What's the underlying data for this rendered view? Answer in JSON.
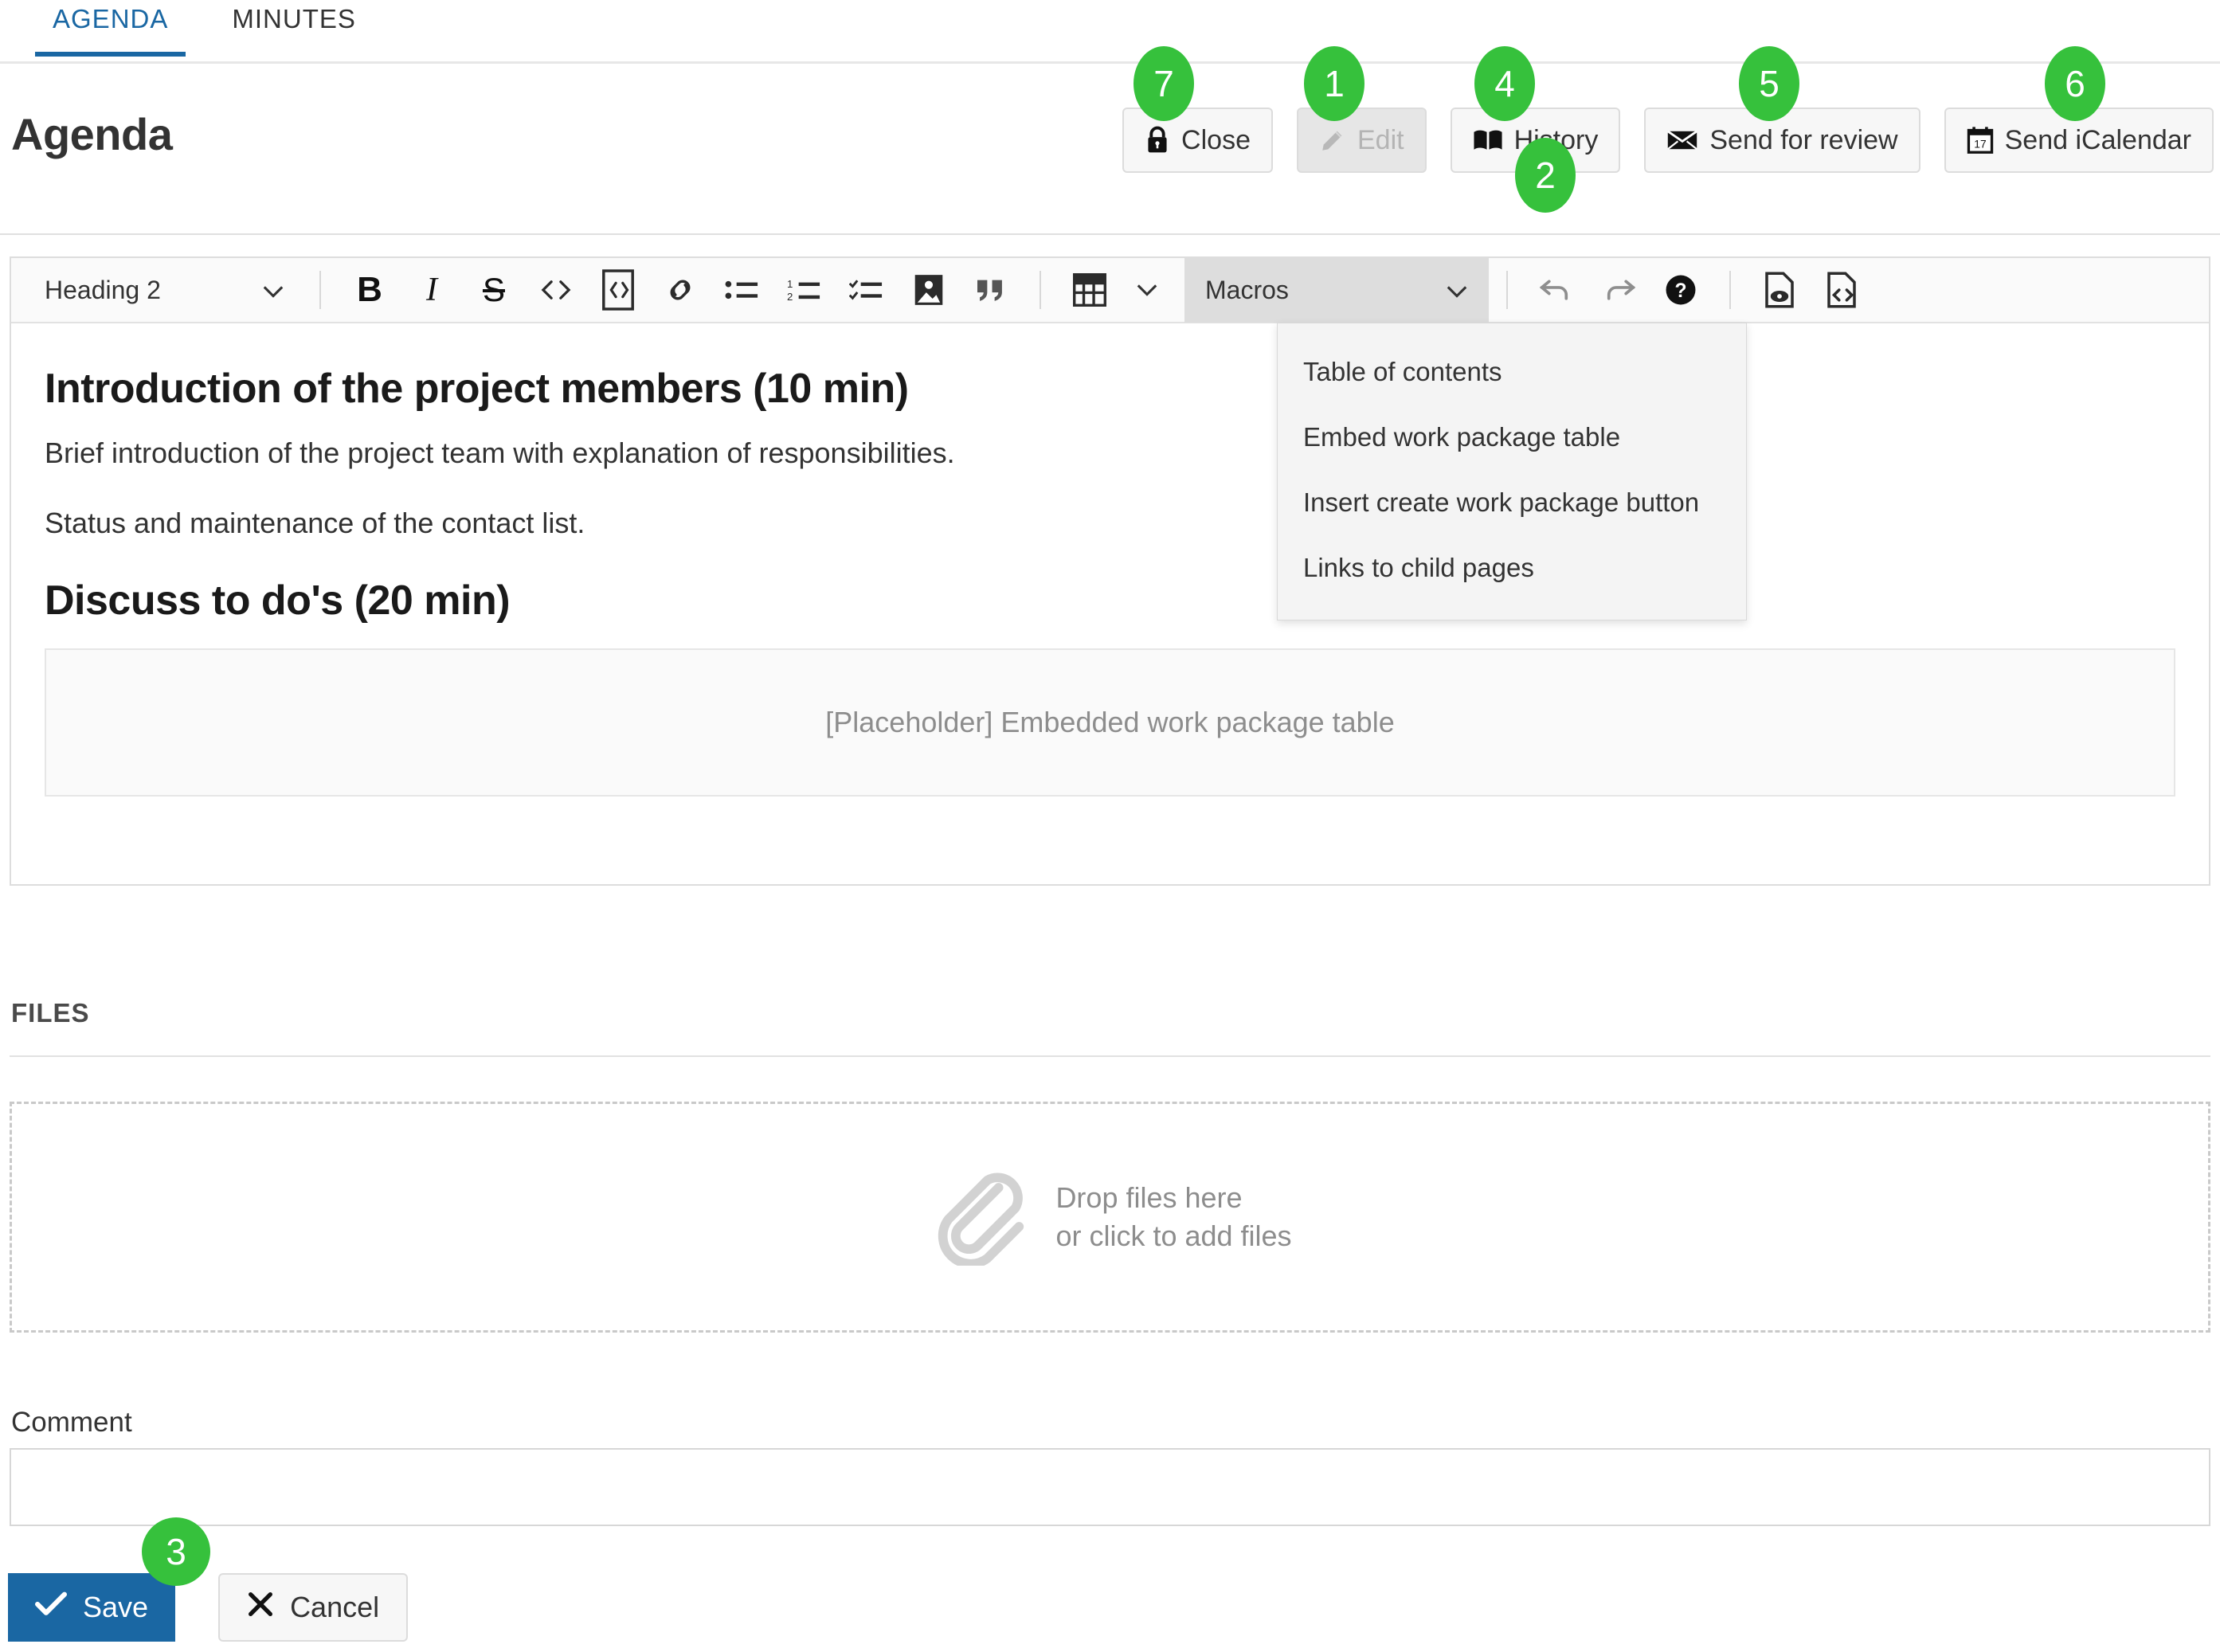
{
  "tabs": [
    {
      "label": "AGENDA",
      "active": true
    },
    {
      "label": "MINUTES",
      "active": false
    }
  ],
  "header": {
    "title": "Agenda",
    "buttons": [
      {
        "label": "Close",
        "icon": "lock-icon",
        "disabled": false,
        "badge": "7"
      },
      {
        "label": "Edit",
        "icon": "pencil-icon",
        "disabled": true,
        "badge": "1"
      },
      {
        "label": "History",
        "icon": "book-icon",
        "disabled": false,
        "badge": "4"
      },
      {
        "label": "Send for review",
        "icon": "envelope-icon",
        "disabled": false,
        "badge": "5"
      },
      {
        "label": "Send iCalendar",
        "icon": "calendar-icon",
        "disabled": false,
        "badge": "6"
      }
    ]
  },
  "editor": {
    "heading_select": {
      "value": "Heading 2"
    },
    "macro_select": {
      "value": "Macros",
      "badge": "2"
    },
    "tools": [
      {
        "name": "bold-icon",
        "label": "B"
      },
      {
        "name": "italic-icon",
        "label": "I"
      },
      {
        "name": "strikethrough-icon",
        "label": "S"
      },
      {
        "name": "inline-code-icon",
        "label": "<>"
      },
      {
        "name": "code-block-icon",
        "label": "<>"
      },
      {
        "name": "link-icon",
        "label": "link"
      },
      {
        "name": "bulleted-list-icon",
        "label": "bullets"
      },
      {
        "name": "numbered-list-icon",
        "label": "numbers"
      },
      {
        "name": "todo-list-icon",
        "label": "todo"
      },
      {
        "name": "image-icon",
        "label": "image"
      },
      {
        "name": "blockquote-icon",
        "label": "quote"
      },
      {
        "name": "table-icon",
        "label": "table"
      },
      {
        "name": "undo-icon",
        "label": "undo"
      },
      {
        "name": "redo-icon",
        "label": "redo"
      },
      {
        "name": "help-icon",
        "label": "help"
      },
      {
        "name": "preview-icon",
        "label": "preview"
      },
      {
        "name": "source-code-icon",
        "label": "source"
      }
    ],
    "macro_menu": [
      "Table of contents",
      "Embed work package table",
      "Insert create work package button",
      "Links to child pages"
    ],
    "content": {
      "heading_1": "Introduction of the project members (10 min)",
      "paragraph_1": "Brief introduction of the project team with explanation of responsibilities.",
      "paragraph_2": "Status and maintenance of the contact list.",
      "heading_2": "Discuss to do's (20 min)",
      "embedded_placeholder": "[Placeholder] Embedded work package table"
    }
  },
  "files": {
    "section_label": "FILES",
    "dropzone_line_1": "Drop files here",
    "dropzone_line_2": "or click to add files",
    "dropzone_icon": "paperclip-icon"
  },
  "comment": {
    "label": "Comment",
    "value": "",
    "placeholder": ""
  },
  "actions": {
    "save_label": "Save",
    "save_badge": "3",
    "cancel_label": "Cancel"
  },
  "colors": {
    "accent_blue": "#1a67a3",
    "badge_green": "#36c13c",
    "toolbar_bg": "#fafafa",
    "macro_active_bg": "#dddddd"
  }
}
